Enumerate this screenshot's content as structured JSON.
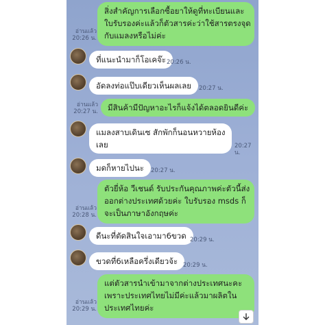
{
  "messages": [
    {
      "dir": "out",
      "text": "สิ่งสำคัญการเลือกซื้อยาให้ดูที่ทะเบียนและใบรับรองค่ะแล้วก็ตัวสารค่ะว่าใช้สารตรงจุดกับแมลงหรือไม่ค่ะ",
      "lines": [
        "สิ่งสำคัญการเลือกซื้อยาให้ดูที่ทะเบียนและ",
        "ใบรับรองค่ะแล้วก็ตัวสารค่ะว่าใช้สารตรงจุด",
        "กับแมลงหรือไม่ค่ะ"
      ],
      "read": "อ่านแล้ว",
      "time": "20:26 น."
    },
    {
      "dir": "in",
      "lines": [
        "ที่แนะนำมาก็โอเคจ๊ะ"
      ],
      "time": "20:26 น."
    },
    {
      "dir": "in",
      "lines": [
        "อัดลงท่อแป๊บเดียวเห็นผลเลย"
      ],
      "time": "20:27 น."
    },
    {
      "dir": "out",
      "lines": [
        "มีสินค้ามีปัญหาอะไรก็แจ้งได้ตลอดยินดีค่ะ"
      ],
      "read": "อ่านแล้ว",
      "time": "20:27 น."
    },
    {
      "dir": "in",
      "lines": [
        "แมลงสาบเดินเซ สักพักก็นอนหวายห้อง",
        "เลย"
      ],
      "time": "20:27 น."
    },
    {
      "dir": "in",
      "lines": [
        "มดก็หายไปนะ"
      ],
      "time": "20:27 น."
    },
    {
      "dir": "out",
      "lines": [
        "ตัวยี่ห้อ วีเชนด์ รับประกันคุณภาพค่ะตัวนี้ส่ง",
        "ออกต่างประเทศด้วยค่ะ ใบรับรอง msds ก็",
        "จะเป็นภาษาอังกฤษค่ะ"
      ],
      "read": "อ่านแล้ว",
      "time": "20:28 น."
    },
    {
      "dir": "in",
      "lines": [
        "ดีนะที่ตัดสินใจเอามา6ขวด"
      ],
      "time": "20:29 น."
    },
    {
      "dir": "in",
      "lines": [
        "ขวดที่6เหลือครึ่งเดียวจ้ะ"
      ],
      "time": "20:29 น."
    },
    {
      "dir": "out",
      "lines": [
        "แต่ตัวสารนำเข้ามาจากต่างประเทศนะคะ",
        "เพราะประเทศไทยไม่มีค่ะแล้วมาผลิตใน",
        "ประเทศไทยค่ะ"
      ],
      "read": "อ่านแล้ว",
      "time": "20:29 น."
    }
  ],
  "icons": {
    "avatar": "contact-avatar",
    "scroll": "arrow-down-icon"
  }
}
